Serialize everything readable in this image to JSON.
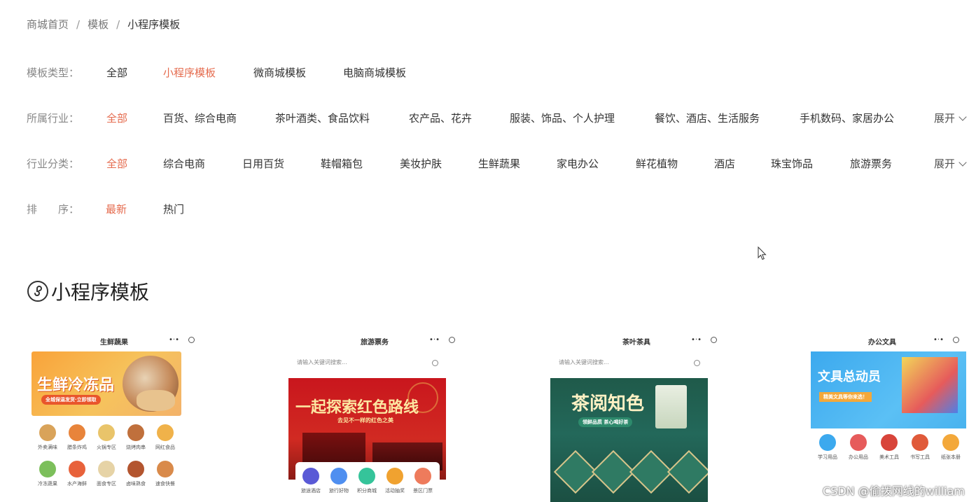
{
  "breadcrumb": {
    "home": "商城首页",
    "sep": "/",
    "templates": "模板",
    "current": "小程序模板"
  },
  "filters": {
    "template_type": {
      "label": "模板类型：",
      "options": [
        "全部",
        "小程序模板",
        "微商城模板",
        "电脑商城模板"
      ]
    },
    "industry": {
      "label": "所属行业：",
      "options": [
        "全部",
        "百货、综合电商",
        "茶叶酒类、食品饮料",
        "农产品、花卉",
        "服装、饰品、个人护理",
        "餐饮、酒店、生活服务",
        "手机数码、家居办公"
      ],
      "expand": "展开"
    },
    "category": {
      "label": "行业分类：",
      "options": [
        "全部",
        "综合电商",
        "日用百货",
        "鞋帽箱包",
        "美妆护肤",
        "生鲜蔬果",
        "家电办公",
        "鲜花植物",
        "酒店",
        "珠宝饰品",
        "旅游票务"
      ],
      "expand": "展开"
    },
    "sort": {
      "label": "排　　序：",
      "options": [
        "最新",
        "热门"
      ]
    }
  },
  "section": {
    "title": "小程序模板"
  },
  "cards": [
    {
      "title": "生鲜蔬果",
      "banner_text": "生鲜冷冻品",
      "banner_sub": "全城保温发货·立即领取",
      "icons": [
        "外卖满味",
        "腊条炸鸡",
        "火锅专区",
        "烧烤肉串",
        "网红食品",
        "冷冻蔬果",
        "水产海鲜",
        "面食专区",
        "卤味熟食",
        "速食快餐"
      ]
    },
    {
      "title": "旅游票务",
      "search_placeholder": "请输入关键词搜索...",
      "banner_text": "一起探索红色路线",
      "banner_sub": "去见不一样的红色之美",
      "icons": [
        "旅途酒店",
        "旅行好物",
        "积分商城",
        "活动抽奖",
        "景区门票"
      ]
    },
    {
      "title": "茶叶茶具",
      "search_placeholder": "请输入关键词搜索...",
      "banner_text": "茶阅知色",
      "banner_sub": "领鲜品质 茶心喝好茶"
    },
    {
      "title": "办公文具",
      "banner_text": "文具总动员",
      "banner_sub": "精美文具等你来选！",
      "icons": [
        "学习用品",
        "办公用品",
        "美术工具",
        "书写工具",
        "纸张本册"
      ]
    }
  ],
  "menu_dots": "•·•",
  "watermark": "CSDN @偷拨网线的william",
  "colors": {
    "accent": "#e56b4e"
  }
}
